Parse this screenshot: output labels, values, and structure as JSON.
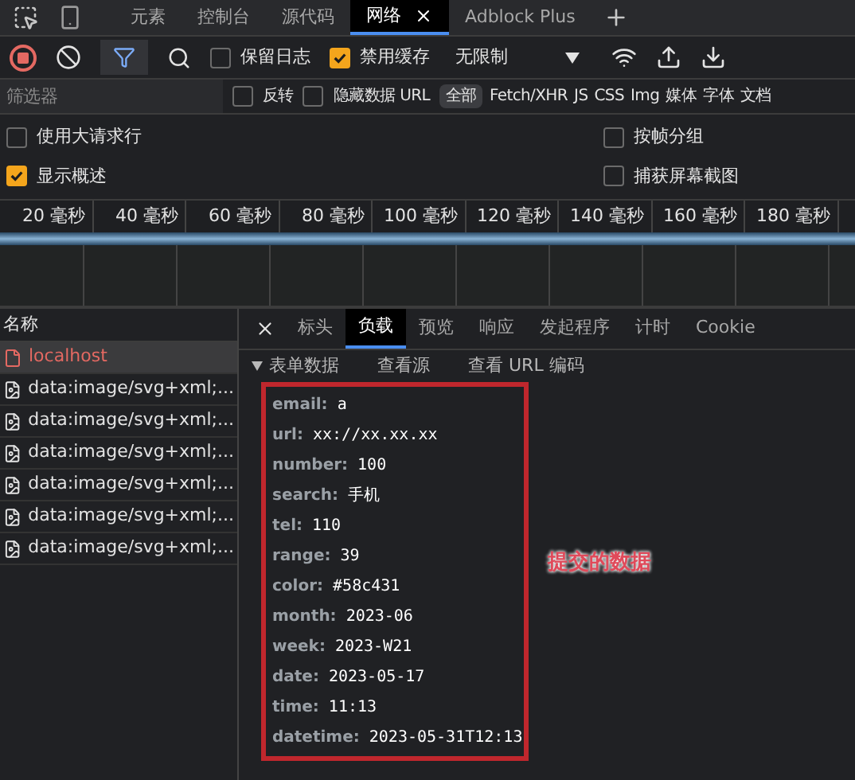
{
  "panel_tabs": [
    {
      "label": "元素",
      "selected": false
    },
    {
      "label": "控制台",
      "selected": false
    },
    {
      "label": "源代码",
      "selected": false
    },
    {
      "label": "网络",
      "selected": true,
      "closable": true
    },
    {
      "label": "Adblock Plus",
      "selected": false
    }
  ],
  "toolbar": {
    "recording": true,
    "preserve_log": {
      "label": "保留日志",
      "checked": false
    },
    "disable_cache": {
      "label": "禁用缓存",
      "checked": true
    },
    "throttle": "无限制"
  },
  "filter": {
    "placeholder": "筛选器",
    "invert": {
      "label": "反转",
      "checked": false
    },
    "hide_data_urls": {
      "label": "隐藏数据 URL",
      "checked": false
    },
    "types": [
      {
        "label": "全部",
        "selected": true
      },
      {
        "label": "Fetch/XHR",
        "selected": false
      },
      {
        "label": "JS",
        "selected": false
      },
      {
        "label": "CSS",
        "selected": false
      },
      {
        "label": "Img",
        "selected": false
      },
      {
        "label": "媒体",
        "selected": false
      },
      {
        "label": "字体",
        "selected": false
      },
      {
        "label": "文档",
        "selected": false
      }
    ]
  },
  "options": [
    {
      "label": "使用大请求行",
      "checked": false
    },
    {
      "label": "按帧分组",
      "checked": false
    },
    {
      "label": "显示概述",
      "checked": true
    },
    {
      "label": "捕获屏幕截图",
      "checked": false
    }
  ],
  "timeline_ticks": [
    "20 毫秒",
    "40 毫秒",
    "60 毫秒",
    "80 毫秒",
    "100 毫秒",
    "120 毫秒",
    "140 毫秒",
    "160 毫秒",
    "180 毫秒"
  ],
  "requests": {
    "header": "名称",
    "rows": [
      {
        "name": "localhost",
        "kind": "document",
        "selected": true
      },
      {
        "name": "data:image/svg+xml;...",
        "kind": "image",
        "selected": false
      },
      {
        "name": "data:image/svg+xml;...",
        "kind": "image",
        "selected": false
      },
      {
        "name": "data:image/svg+xml;...",
        "kind": "image",
        "selected": false
      },
      {
        "name": "data:image/svg+xml;...",
        "kind": "image",
        "selected": false
      },
      {
        "name": "data:image/svg+xml;...",
        "kind": "image",
        "selected": false
      },
      {
        "name": "data:image/svg+xml;...",
        "kind": "image",
        "selected": false
      }
    ]
  },
  "details": {
    "tabs": [
      {
        "label": "标头",
        "selected": false
      },
      {
        "label": "负载",
        "selected": true
      },
      {
        "label": "预览",
        "selected": false
      },
      {
        "label": "响应",
        "selected": false
      },
      {
        "label": "发起程序",
        "selected": false
      },
      {
        "label": "计时",
        "selected": false
      },
      {
        "label": "Cookie",
        "selected": false
      }
    ],
    "section": {
      "title": "表单数据",
      "expanded": true,
      "links": [
        "查看源",
        "查看 URL 编码"
      ]
    },
    "fields": [
      {
        "key": "email:",
        "value": "a"
      },
      {
        "key": "url:",
        "value": "xx://xx.xx.xx"
      },
      {
        "key": "number:",
        "value": "100"
      },
      {
        "key": "search:",
        "value": "手机"
      },
      {
        "key": "tel:",
        "value": "110"
      },
      {
        "key": "range:",
        "value": "39"
      },
      {
        "key": "color:",
        "value": "#58c431"
      },
      {
        "key": "month:",
        "value": "2023-06"
      },
      {
        "key": "week:",
        "value": "2023-W21"
      },
      {
        "key": "date:",
        "value": "2023-05-17"
      },
      {
        "key": "time:",
        "value": "11:13"
      },
      {
        "key": "datetime:",
        "value": "2023-05-31T12:13"
      }
    ]
  },
  "annotation": "提交的数据"
}
